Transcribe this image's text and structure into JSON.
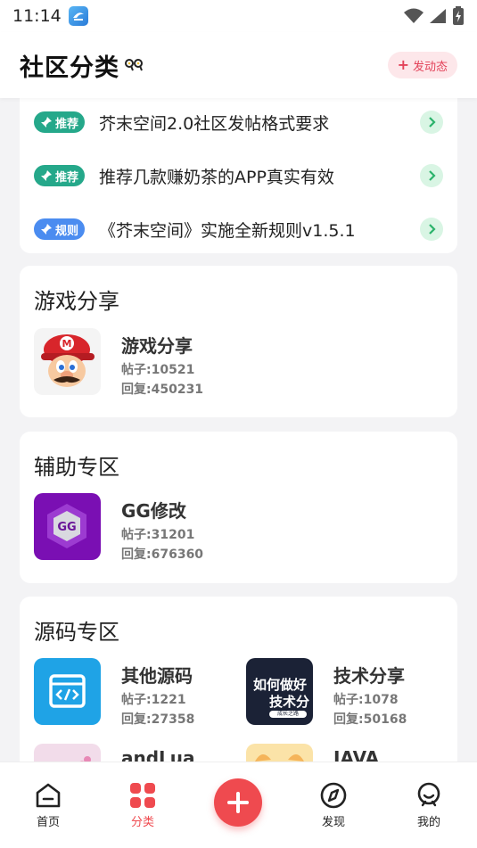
{
  "status": {
    "time": "11:14"
  },
  "header": {
    "title": "社区分类",
    "post_button": "发动态"
  },
  "notices": [
    {
      "tag": "推荐",
      "text": "芥末空间2.0社区发帖格式要求"
    },
    {
      "tag": "推荐",
      "text": "推荐几款赚奶茶的APP真实有效"
    },
    {
      "tag": "规则",
      "text": "《芥末空间》实施全新规则v1.5.1"
    }
  ],
  "sections": [
    {
      "title": "游戏分享",
      "items": [
        {
          "name": "游戏分享",
          "posts": "帖子:10521",
          "replies": "回复:450231"
        }
      ]
    },
    {
      "title": "辅助专区",
      "items": [
        {
          "name": "GG修改",
          "posts": "帖子:31201",
          "replies": "回复:676360"
        }
      ]
    },
    {
      "title": "源码专区",
      "items": [
        {
          "name": "其他源码",
          "posts": "帖子:1221",
          "replies": "回复:27358"
        },
        {
          "name": "技术分享",
          "posts": "帖子:1078",
          "replies": "回复:50168",
          "icon_text_1": "如何做好",
          "icon_text_2": "技术分",
          "icon_text_3": "成长之路"
        },
        {
          "name": "andLua",
          "posts": "",
          "replies": ""
        },
        {
          "name": "JAVA",
          "posts": "",
          "replies": ""
        }
      ]
    }
  ],
  "nav": [
    {
      "label": "首页",
      "icon": "home-icon"
    },
    {
      "label": "分类",
      "icon": "category-icon"
    },
    {
      "label": "发现",
      "icon": "compass-icon"
    },
    {
      "label": "我的",
      "icon": "profile-icon"
    }
  ],
  "colors": {
    "accent": "#ef4a4f",
    "tag_green": "#25a88a",
    "tag_blue": "#4b8cf0"
  }
}
